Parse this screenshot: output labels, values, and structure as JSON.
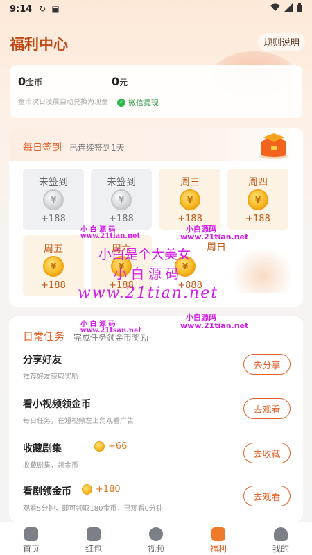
{
  "status_bar": {
    "time": "9:14",
    "icons": [
      "sync-icon",
      "a-icon"
    ],
    "right_icons": [
      "wifi-icon",
      "signal-icon",
      "battery-icon"
    ]
  },
  "header": {
    "title": "福利中心",
    "rules_label": "规则说明"
  },
  "balance": {
    "coins_value": "0",
    "coins_unit": "金币",
    "coins_note": "金币次日凌晨自动兑换为现金",
    "cash_value": "0",
    "cash_unit": "元",
    "withdraw_label": "微信提现"
  },
  "checkin": {
    "title": "每日签到",
    "subtitle": "已连续签到1天",
    "days": [
      {
        "label": "未签到",
        "reward": "+188",
        "state": "unsigned"
      },
      {
        "label": "未签到",
        "reward": "+188",
        "state": "unsigned"
      },
      {
        "label": "周三",
        "reward": "+188",
        "state": "upcoming"
      },
      {
        "label": "周四",
        "reward": "+188",
        "state": "upcoming"
      },
      {
        "label": "周五",
        "reward": "+188",
        "state": "upcoming"
      },
      {
        "label": "周六",
        "reward": "+188",
        "state": "upcoming"
      },
      {
        "label": "周日",
        "reward": "+888",
        "state": "upcoming"
      }
    ]
  },
  "tasks": {
    "title": "日常任务",
    "subtitle": "完成任务领金币奖励",
    "items": [
      {
        "name": "分享好友",
        "desc": "推荐好友获取奖励",
        "reward": "",
        "button": "去分享"
      },
      {
        "name": "看小视频领金币",
        "desc": "每日任务，在短视频左上角观看广告",
        "reward": "",
        "button": "去观看"
      },
      {
        "name": "收藏剧集",
        "desc": "收藏剧集，领金币",
        "reward": "+66",
        "button": "去收藏"
      },
      {
        "name": "看剧领金币",
        "desc": "观看5分钟，即可领取180金币，已观看0分钟",
        "reward": "+180",
        "button": "去观看"
      }
    ]
  },
  "watermarks": {
    "brand_small": "小白源码",
    "brand_spaced": "小 白 源 码",
    "domain_small": "www.21tian.net",
    "domain_alt": "www.21tsan.net",
    "slogan": "小白是个大美女",
    "brand_wide": "小白源码",
    "domain_big": "www.21tian.net"
  },
  "tabbar": [
    {
      "label": "首页",
      "icon": "home-icon"
    },
    {
      "label": "红包",
      "icon": "red-envelope-icon"
    },
    {
      "label": "视频",
      "icon": "play-icon"
    },
    {
      "label": "福利",
      "icon": "gift-icon",
      "active": true
    },
    {
      "label": "我的",
      "icon": "profile-icon"
    }
  ],
  "colors": {
    "accent": "#e2622a",
    "coin": "#f7b823",
    "wechat_green": "#2fb84a"
  }
}
